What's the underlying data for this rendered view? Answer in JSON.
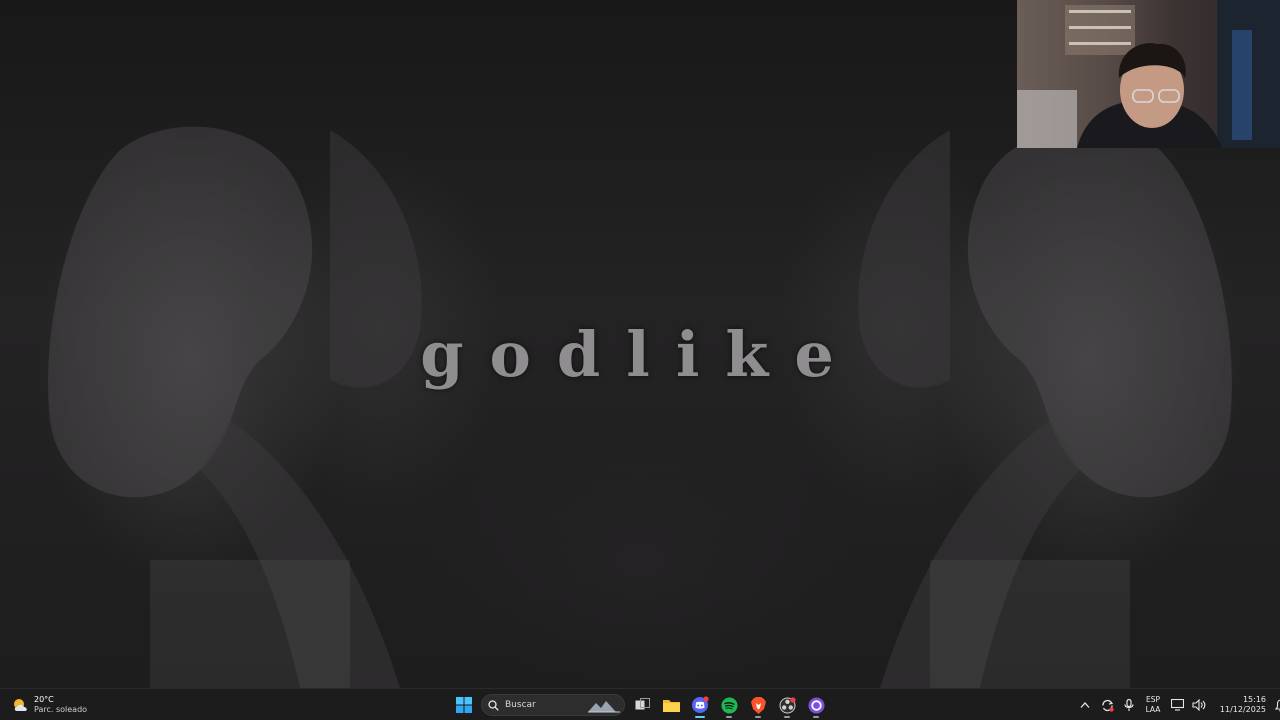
{
  "wallpaper": {
    "title": "godlike"
  },
  "webcam": {
    "icon": "webcam-person-icon"
  },
  "taskbar": {
    "weather": {
      "temperature": "20°C",
      "condition": "Parc. soleado",
      "icon": "partly-sunny-icon"
    },
    "search": {
      "placeholder": "Buscar"
    },
    "apps": [
      {
        "name": "start",
        "icon": "windows-logo-icon"
      },
      {
        "name": "task-view",
        "icon": "task-view-icon"
      },
      {
        "name": "file-explorer",
        "icon": "folder-icon"
      },
      {
        "name": "discord",
        "icon": "discord-icon",
        "accent": "#5865f2",
        "active": true
      },
      {
        "name": "spotify",
        "icon": "spotify-icon",
        "accent": "#1db954"
      },
      {
        "name": "brave",
        "icon": "brave-lion-icon",
        "accent": "#fb542b"
      },
      {
        "name": "obs",
        "icon": "obs-icon",
        "accent": "#d0d0d0"
      },
      {
        "name": "app-purple",
        "icon": "purple-circle-icon",
        "accent": "#7b4fe0"
      }
    ],
    "tray": {
      "language_top": "ESP",
      "language_bottom": "LAA",
      "time": "15:16",
      "date": "11/12/2025"
    }
  }
}
